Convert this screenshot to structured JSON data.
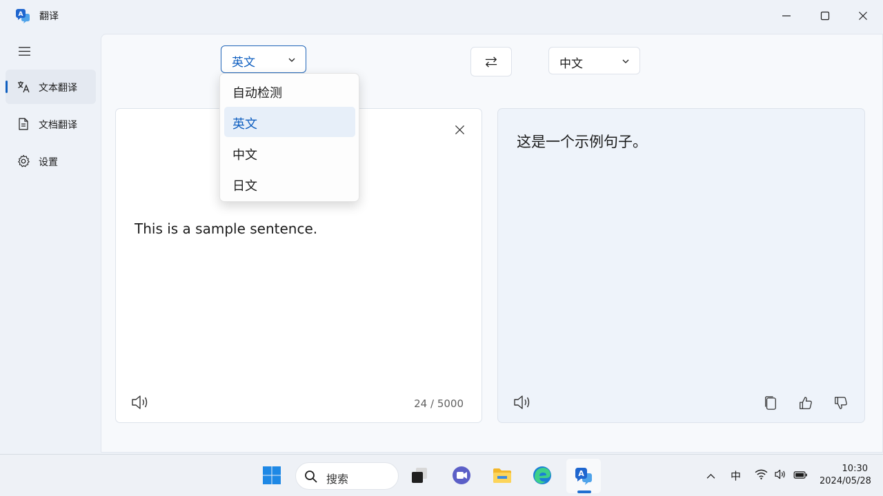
{
  "window": {
    "title": "翻译",
    "controls": {
      "minimize": "minimize",
      "maximize": "maximize",
      "close": "close"
    }
  },
  "sidebar": {
    "items": [
      {
        "label": "文本翻译",
        "icon": "translate-icon",
        "active": true
      },
      {
        "label": "文档翻译",
        "icon": "document-icon",
        "active": false
      },
      {
        "label": "设置",
        "icon": "gear-icon",
        "active": false
      }
    ]
  },
  "toolbar": {
    "source_language": "英文",
    "target_language": "中文"
  },
  "dropdown": {
    "options": [
      "自动检测",
      "英文",
      "中文",
      "日文"
    ],
    "selected": "英文"
  },
  "source_panel": {
    "text": "This is a sample sentence.",
    "char_count": "24 / 5000"
  },
  "target_panel": {
    "text": "这是一个示例句子。"
  },
  "taskbar": {
    "search_placeholder": "搜索",
    "ime": "中",
    "time": "10:30",
    "date": "2024/05/28"
  },
  "colors": {
    "accent": "#0f5fc0",
    "window_bg": "#eef2f8",
    "target_panel_bg": "#eef3fa"
  }
}
